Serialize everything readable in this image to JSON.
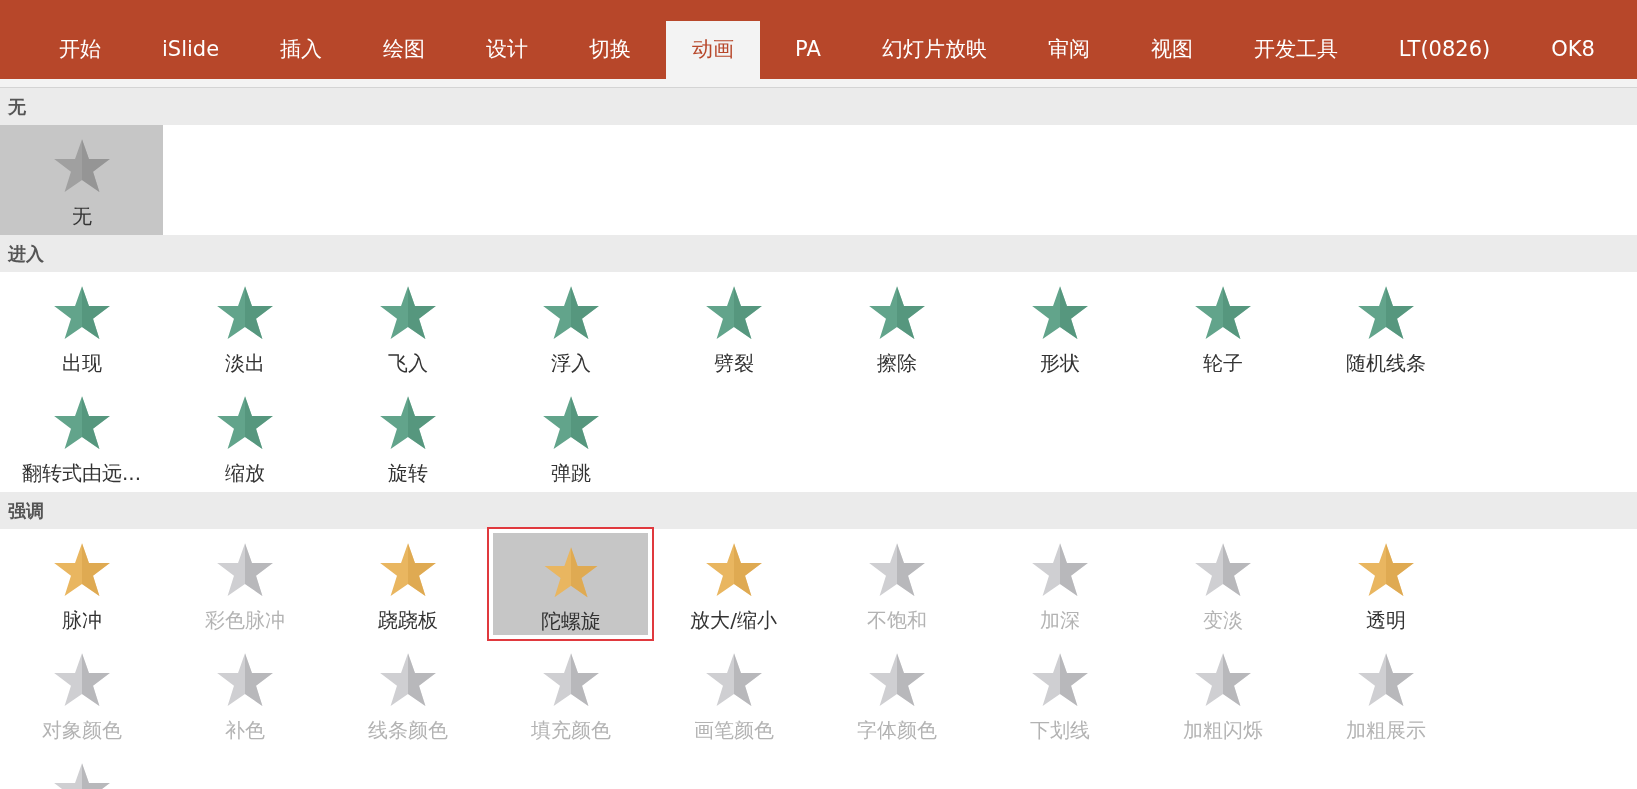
{
  "tabs": [
    {
      "label": "开始",
      "selected": false
    },
    {
      "label": "iSlide",
      "selected": false
    },
    {
      "label": "插入",
      "selected": false
    },
    {
      "label": "绘图",
      "selected": false
    },
    {
      "label": "设计",
      "selected": false
    },
    {
      "label": "切换",
      "selected": false
    },
    {
      "label": "动画",
      "selected": true
    },
    {
      "label": "PA",
      "selected": false
    },
    {
      "label": "幻灯片放映",
      "selected": false
    },
    {
      "label": "审阅",
      "selected": false
    },
    {
      "label": "视图",
      "selected": false
    },
    {
      "label": "开发工具",
      "selected": false
    },
    {
      "label": "LT(0826)",
      "selected": false
    },
    {
      "label": "OK8",
      "selected": false
    }
  ],
  "sections": [
    {
      "kind": "none",
      "title": "无",
      "items": [
        {
          "label": "无",
          "selected": true,
          "hovered": false,
          "disabled": false
        }
      ]
    },
    {
      "kind": "entrance",
      "title": "进入",
      "items": [
        {
          "label": "出现",
          "selected": false,
          "hovered": false,
          "disabled": false
        },
        {
          "label": "淡出",
          "selected": false,
          "hovered": false,
          "disabled": false
        },
        {
          "label": "飞入",
          "selected": false,
          "hovered": false,
          "disabled": false
        },
        {
          "label": "浮入",
          "selected": false,
          "hovered": false,
          "disabled": false
        },
        {
          "label": "劈裂",
          "selected": false,
          "hovered": false,
          "disabled": false
        },
        {
          "label": "擦除",
          "selected": false,
          "hovered": false,
          "disabled": false
        },
        {
          "label": "形状",
          "selected": false,
          "hovered": false,
          "disabled": false
        },
        {
          "label": "轮子",
          "selected": false,
          "hovered": false,
          "disabled": false
        },
        {
          "label": "随机线条",
          "selected": false,
          "hovered": false,
          "disabled": false
        },
        {
          "label": "翻转式由远...",
          "selected": false,
          "hovered": false,
          "disabled": false
        },
        {
          "label": "缩放",
          "selected": false,
          "hovered": false,
          "disabled": false
        },
        {
          "label": "旋转",
          "selected": false,
          "hovered": false,
          "disabled": false
        },
        {
          "label": "弹跳",
          "selected": false,
          "hovered": false,
          "disabled": false
        }
      ]
    },
    {
      "kind": "emphasis",
      "title": "强调",
      "items": [
        {
          "label": "脉冲",
          "selected": false,
          "hovered": false,
          "disabled": false
        },
        {
          "label": "彩色脉冲",
          "selected": false,
          "hovered": false,
          "disabled": true
        },
        {
          "label": "跷跷板",
          "selected": false,
          "hovered": false,
          "disabled": false
        },
        {
          "label": "陀螺旋",
          "selected": true,
          "hovered": true,
          "disabled": false
        },
        {
          "label": "放大/缩小",
          "selected": false,
          "hovered": false,
          "disabled": false
        },
        {
          "label": "不饱和",
          "selected": false,
          "hovered": false,
          "disabled": true
        },
        {
          "label": "加深",
          "selected": false,
          "hovered": false,
          "disabled": true
        },
        {
          "label": "变淡",
          "selected": false,
          "hovered": false,
          "disabled": true
        },
        {
          "label": "透明",
          "selected": false,
          "hovered": false,
          "disabled": false
        },
        {
          "label": "对象颜色",
          "selected": false,
          "hovered": false,
          "disabled": true
        },
        {
          "label": "补色",
          "selected": false,
          "hovered": false,
          "disabled": true
        },
        {
          "label": "线条颜色",
          "selected": false,
          "hovered": false,
          "disabled": true
        },
        {
          "label": "填充颜色",
          "selected": false,
          "hovered": false,
          "disabled": true
        },
        {
          "label": "画笔颜色",
          "selected": false,
          "hovered": false,
          "disabled": true
        },
        {
          "label": "字体颜色",
          "selected": false,
          "hovered": false,
          "disabled": true
        },
        {
          "label": "下划线",
          "selected": false,
          "hovered": false,
          "disabled": true
        },
        {
          "label": "加粗闪烁",
          "selected": false,
          "hovered": false,
          "disabled": true
        },
        {
          "label": "加粗展示",
          "selected": false,
          "hovered": false,
          "disabled": true
        },
        {
          "selected": false,
          "hovered": false,
          "disabled": true
        }
      ]
    }
  ]
}
